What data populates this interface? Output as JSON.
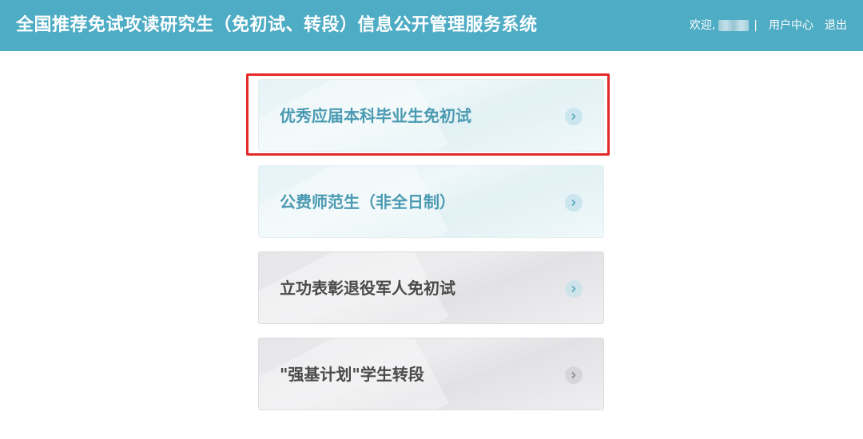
{
  "header": {
    "title": "全国推荐免试攻读研究生（免初试、转段）信息公开管理服务系统",
    "welcome": "欢迎,",
    "separator": "|",
    "user_center": "用户中心",
    "logout": "退出"
  },
  "menu": {
    "items": [
      {
        "label": "优秀应届本科毕业生免初试",
        "style": "blue",
        "icon": "chevron-right-icon",
        "highlighted": true
      },
      {
        "label": "公费师范生（非全日制）",
        "style": "blue",
        "icon": "chevron-right-icon",
        "highlighted": false
      },
      {
        "label": "立功表彰退役军人免初试",
        "style": "gray",
        "icon": "chevron-right-icon",
        "highlighted": false
      },
      {
        "label": "\"强基计划\"学生转段",
        "style": "gray",
        "icon": "chevron-right-icon",
        "highlighted": false
      }
    ]
  },
  "colors": {
    "header_bg": "#4eacc4",
    "blue_label": "#4a9ab2",
    "gray_label": "#4a4a4a",
    "highlight": "#e52929"
  }
}
